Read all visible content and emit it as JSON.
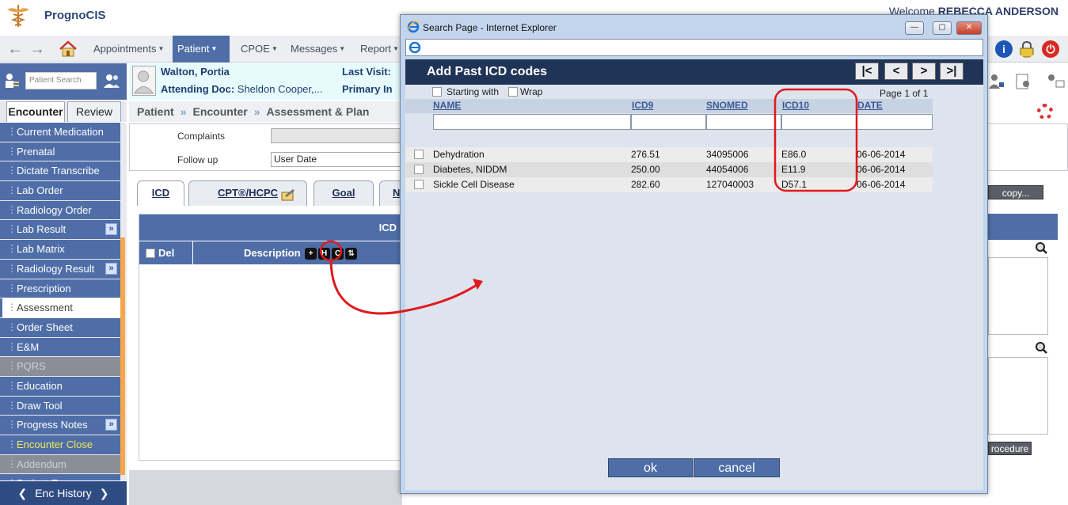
{
  "app": {
    "name": "PrognoCIS",
    "welcome_prefix": "Welcome ",
    "user": "REBECCA ANDERSON"
  },
  "nav": {
    "menus": [
      {
        "label": "Appointments",
        "active": false
      },
      {
        "label": "Patient",
        "active": true
      },
      {
        "label": "CPOE",
        "active": false
      },
      {
        "label": "Messages",
        "active": false
      },
      {
        "label": "Report",
        "active": false
      }
    ]
  },
  "patient_search": {
    "placeholder": "Patient Search"
  },
  "patient": {
    "name": "Walton, Portia",
    "attending_label": "Attending Doc:",
    "attending_value": "Sheldon Cooper,...",
    "last_visit_label": "Last Visit:",
    "primary_label": "Primary In"
  },
  "sidebar": {
    "tabs": [
      "Encounter",
      "Review"
    ],
    "items": [
      {
        "label": "Current Medication",
        "state": "normal",
        "expand": false
      },
      {
        "label": "Prenatal",
        "state": "normal",
        "expand": false
      },
      {
        "label": "Dictate Transcribe",
        "state": "normal",
        "expand": false
      },
      {
        "label": "Lab Order",
        "state": "normal",
        "expand": false
      },
      {
        "label": "Radiology Order",
        "state": "normal",
        "expand": false
      },
      {
        "label": "Lab Result",
        "state": "normal",
        "expand": true
      },
      {
        "label": "Lab Matrix",
        "state": "normal",
        "expand": false
      },
      {
        "label": "Radiology Result",
        "state": "normal",
        "expand": true
      },
      {
        "label": "Prescription",
        "state": "normal",
        "expand": false
      },
      {
        "label": "Assessment",
        "state": "active",
        "expand": false
      },
      {
        "label": "Order Sheet",
        "state": "normal",
        "expand": false
      },
      {
        "label": "E&M",
        "state": "normal",
        "expand": false
      },
      {
        "label": "PQRS",
        "state": "disabled",
        "expand": false
      },
      {
        "label": "Education",
        "state": "normal",
        "expand": false
      },
      {
        "label": "Draw Tool",
        "state": "normal",
        "expand": false
      },
      {
        "label": "Progress Notes",
        "state": "normal",
        "expand": true
      },
      {
        "label": "Encounter Close",
        "state": "highlight",
        "expand": false
      },
      {
        "label": "Addendum",
        "state": "disabled",
        "expand": false
      },
      {
        "label": "Patient Forms",
        "state": "normal",
        "expand": false
      }
    ],
    "enc_history": "Enc History"
  },
  "breadcrumb": [
    "Patient",
    "Encounter",
    "Assessment & Plan"
  ],
  "form": {
    "complaints_label": "Complaints",
    "followup_label": "Follow up",
    "followup_value": "User Date"
  },
  "tabs": [
    {
      "label": "ICD",
      "active": true
    },
    {
      "label": "CPT®/HCPC",
      "active": false
    },
    {
      "label": "Goal",
      "active": false
    },
    {
      "label": "N",
      "active": false
    }
  ],
  "icd_panel": {
    "header": "ICD",
    "del_label": "Del",
    "desc_label": "Description",
    "btn_plus": "+",
    "btn_h": "H",
    "btn_c": "C",
    "btn_sort": "⇅"
  },
  "right_side": {
    "copy_label": "copy...",
    "procedure_label": "rocedure"
  },
  "popup": {
    "window_title": "Search Page - Internet Explorer",
    "heading": "Add Past ICD codes",
    "pager": {
      "first": "|<",
      "prev": "<",
      "next": ">",
      "last": ">|"
    },
    "starting_with_label": "Starting with",
    "wrap_label": "Wrap",
    "page_info": "Page 1 of 1",
    "columns": [
      "NAME",
      "ICD9",
      "SNOMED",
      "ICD10",
      "DATE"
    ],
    "rows": [
      {
        "name": "Dehydration",
        "icd9": "276.51",
        "snomed": "34095006",
        "icd10": "E86.0",
        "date": "06-06-2014"
      },
      {
        "name": "Diabetes, NIDDM",
        "icd9": "250.00",
        "snomed": "44054006",
        "icd10": "E11.9",
        "date": "06-06-2014"
      },
      {
        "name": "Sickle Cell Disease",
        "icd9": "282.60",
        "snomed": "127040003",
        "icd10": "D57.1",
        "date": "06-06-2014"
      }
    ],
    "ok_label": "ok",
    "cancel_label": "cancel"
  },
  "colors": {
    "nav_blue": "#4f6ea8",
    "dark_header": "#1f3457",
    "annotation_red": "#e0191e"
  }
}
